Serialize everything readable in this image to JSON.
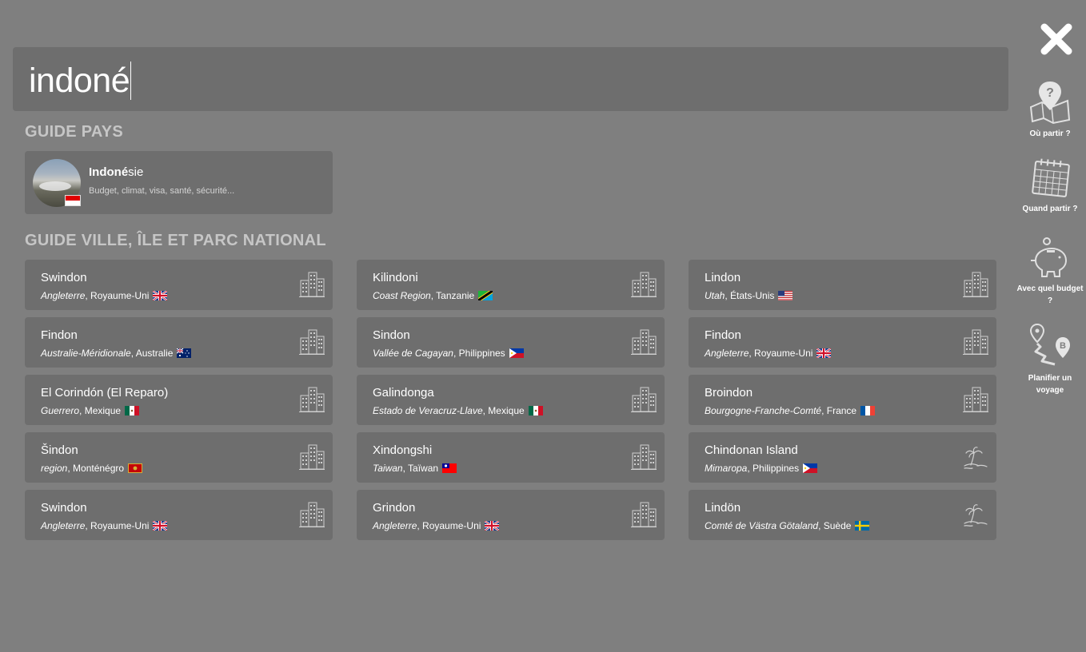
{
  "search": {
    "value": "indoné"
  },
  "sections": {
    "country_title": "GUIDE PAYS",
    "city_title": "GUIDE VILLE, ÎLE ET PARC NATIONAL"
  },
  "country": {
    "name_match": "Indoné",
    "name_rest": "sie",
    "subtitle": "Budget, climat, visa, santé, sécurité...",
    "flag": "flag-indonesia"
  },
  "cities": [
    {
      "name": "Swindon",
      "region": "Angleterre",
      "country": "Royaume-Uni",
      "flag": "flag-uk",
      "icon": "city-buildings-icon"
    },
    {
      "name": "Kilindoni",
      "region": "Coast Region",
      "country": "Tanzanie",
      "flag": "flag-tanzania",
      "icon": "city-buildings-icon"
    },
    {
      "name": "Lindon",
      "region": "Utah",
      "country": "États-Unis",
      "flag": "flag-usa",
      "icon": "city-buildings-icon"
    },
    {
      "name": "Findon",
      "region": "Australie-Méridionale",
      "country": "Australie",
      "flag": "flag-australia",
      "icon": "city-buildings-icon"
    },
    {
      "name": "Sindon",
      "region": "Vallée de Cagayan",
      "country": "Philippines",
      "flag": "flag-philippines",
      "icon": "city-buildings-icon"
    },
    {
      "name": "Findon",
      "region": "Angleterre",
      "country": "Royaume-Uni",
      "flag": "flag-uk",
      "icon": "city-buildings-icon"
    },
    {
      "name": "El Corindón (El Reparo)",
      "region": "Guerrero",
      "country": "Mexique",
      "flag": "flag-mexico",
      "icon": "city-buildings-icon"
    },
    {
      "name": "Galindonga",
      "region": "Estado de Veracruz-Llave",
      "country": "Mexique",
      "flag": "flag-mexico",
      "icon": "city-buildings-icon"
    },
    {
      "name": "Broindon",
      "region": "Bourgogne-Franche-Comté",
      "country": "France",
      "flag": "flag-france",
      "icon": "city-buildings-icon"
    },
    {
      "name": "Šindon",
      "region": "region",
      "country": "Monténégro",
      "flag": "flag-montenegro",
      "icon": "city-buildings-icon"
    },
    {
      "name": "Xindongshi",
      "region": "Taiwan",
      "country": "Taïwan",
      "flag": "flag-taiwan",
      "icon": "city-buildings-icon"
    },
    {
      "name": "Chindonan Island",
      "region": "Mimaropa",
      "country": "Philippines",
      "flag": "flag-philippines",
      "icon": "island-palm-icon"
    },
    {
      "name": "Swindon",
      "region": "Angleterre",
      "country": "Royaume-Uni",
      "flag": "flag-uk",
      "icon": "city-buildings-icon"
    },
    {
      "name": "Grindon",
      "region": "Angleterre",
      "country": "Royaume-Uni",
      "flag": "flag-uk",
      "icon": "city-buildings-icon"
    },
    {
      "name": "Lindön",
      "region": "Comté de Västra Götaland",
      "country": "Suède",
      "flag": "flag-sweden",
      "icon": "island-palm-icon"
    }
  ],
  "sidebar": {
    "close_icon": "close-icon",
    "items": [
      {
        "label": "Où partir ?",
        "icon": "map-question-icon"
      },
      {
        "label": "Quand partir ?",
        "icon": "calendar-icon"
      },
      {
        "label": "Avec quel budget ?",
        "icon": "piggy-bank-icon"
      },
      {
        "label": "Planifier un voyage",
        "icon": "route-ab-icon"
      }
    ]
  },
  "colors": {
    "background": "#7f7f7f",
    "card": "#6e6e6e",
    "section_title": "#c6c6c6"
  }
}
